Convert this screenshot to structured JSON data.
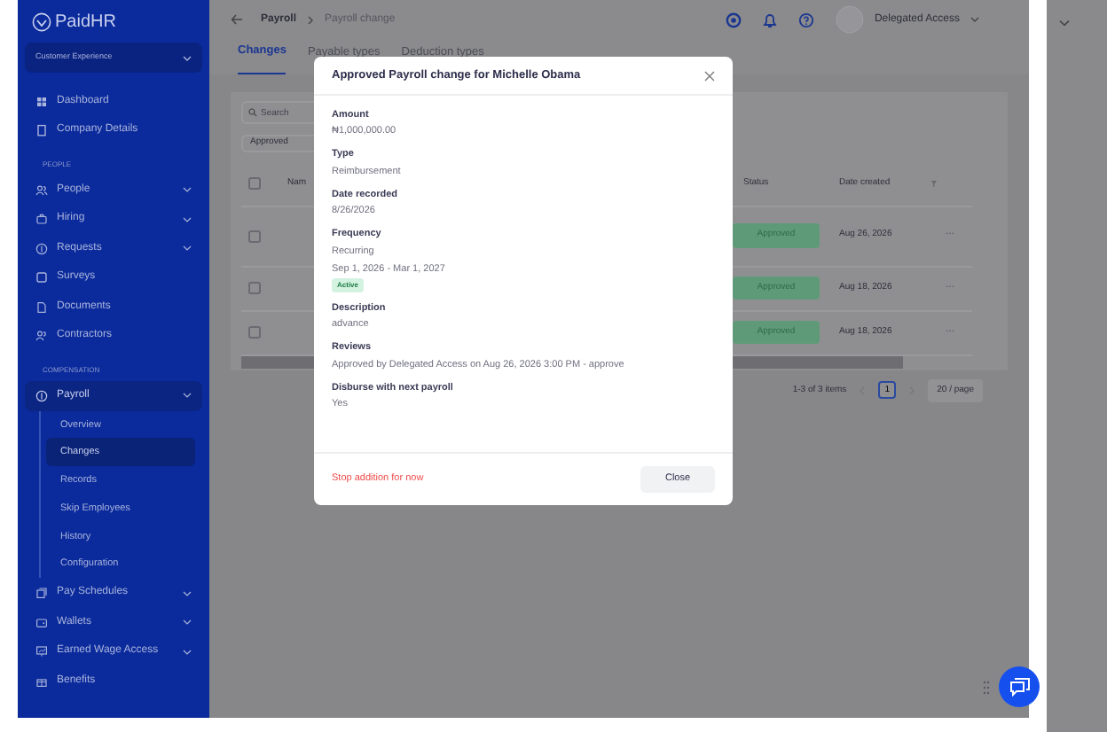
{
  "brand": "PaidHR",
  "workspace": "Customer Experience",
  "sidebar": {
    "items": [
      {
        "kind": "link",
        "label": "Dashboard",
        "selected": false
      },
      {
        "kind": "link",
        "label": "Company Details",
        "selected": false
      },
      {
        "kind": "section",
        "label": "PEOPLE"
      },
      {
        "kind": "group",
        "label": "People",
        "selected": false
      },
      {
        "kind": "group",
        "label": "Hiring",
        "selected": false
      },
      {
        "kind": "group",
        "label": "Requests",
        "selected": false
      },
      {
        "kind": "link",
        "label": "Surveys",
        "selected": false
      },
      {
        "kind": "link",
        "label": "Documents",
        "selected": false
      },
      {
        "kind": "link",
        "label": "Contractors",
        "selected": false
      },
      {
        "kind": "section",
        "label": "COMPENSATION"
      },
      {
        "kind": "group",
        "label": "Payroll",
        "expanded": true,
        "children": [
          {
            "label": "Overview",
            "selected": false
          },
          {
            "label": "Changes",
            "selected": true
          },
          {
            "label": "Records",
            "selected": false
          },
          {
            "label": "Skip Employees",
            "selected": false
          },
          {
            "label": "History",
            "selected": false
          },
          {
            "label": "Configuration",
            "selected": false
          }
        ]
      },
      {
        "kind": "group",
        "label": "Pay Schedules",
        "selected": false
      },
      {
        "kind": "group",
        "label": "Wallets",
        "selected": false
      },
      {
        "kind": "group",
        "label": "Earned Wage Access",
        "selected": false
      },
      {
        "kind": "link",
        "label": "Benefits",
        "selected": false
      }
    ]
  },
  "header": {
    "breadcrumb": [
      "Payroll",
      "Payroll change"
    ],
    "user": "Delegated Access"
  },
  "tabs": [
    {
      "label": "Changes",
      "selected": true
    },
    {
      "label": "Payable types",
      "selected": false
    },
    {
      "label": "Deduction types",
      "selected": false
    }
  ],
  "search": {
    "placeholder": "Search"
  },
  "status_filter": "Approved",
  "table": {
    "select_all_checked": false,
    "columns": [
      "Nam",
      "Status",
      "Date created"
    ],
    "rows": [
      {
        "checked": false,
        "status": "Approved",
        "date": "Aug 26, 2026",
        "actions": "···"
      },
      {
        "checked": false,
        "status": "Approved",
        "date": "Aug 18, 2026",
        "actions": "···"
      },
      {
        "checked": false,
        "status": "Approved",
        "date": "Aug 18, 2026",
        "actions": "···"
      }
    ]
  },
  "pagination": {
    "summary": "1-3 of 3 items",
    "pages": [
      {
        "label": "1",
        "selected": true
      }
    ],
    "page_size": "20 / page"
  },
  "modal": {
    "title": "Approved Payroll change for Michelle Obama",
    "fields": [
      {
        "label": "Amount",
        "values": [
          "₦1,000,000.00"
        ]
      },
      {
        "label": "Type",
        "values": [
          "Reimbursement"
        ]
      },
      {
        "label": "Date recorded",
        "values": [
          "8/26/2026"
        ]
      },
      {
        "label": "Frequency",
        "values": [
          "Recurring",
          "Sep 1, 2026 - Mar 1, 2027"
        ],
        "badge": "Active"
      },
      {
        "label": "Description",
        "values": [
          "advance"
        ]
      },
      {
        "label": "Reviews",
        "values": [
          "Approved by Delegated Access on Aug 26, 2026 3:00 PM - approve"
        ]
      },
      {
        "label": "Disburse with next payroll",
        "values": [
          "Yes"
        ]
      }
    ],
    "link": "Stop addition for now",
    "button": "Close"
  }
}
